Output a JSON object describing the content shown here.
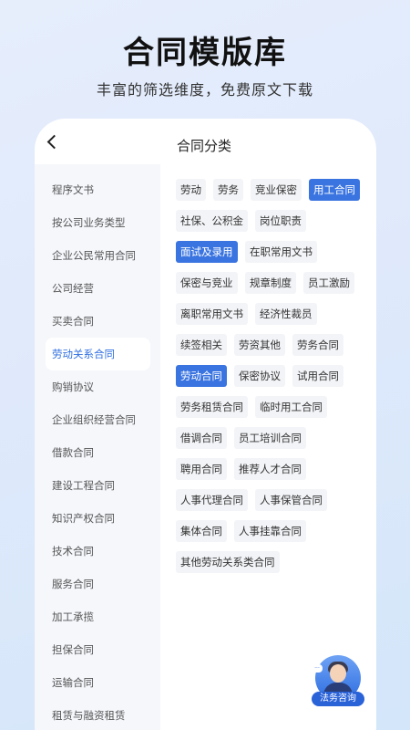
{
  "hero": {
    "title": "合同模版库",
    "subtitle": "丰富的筛选维度，免费原文下载"
  },
  "header": {
    "back_icon": "chevron-left-icon",
    "title": "合同分类"
  },
  "sidebar": {
    "items": [
      {
        "label": "程序文书",
        "active": false
      },
      {
        "label": "按公司业务类型",
        "active": false
      },
      {
        "label": "企业公民常用合同",
        "active": false
      },
      {
        "label": "公司经营",
        "active": false
      },
      {
        "label": "买卖合同",
        "active": false
      },
      {
        "label": "劳动关系合同",
        "active": true
      },
      {
        "label": "购销协议",
        "active": false
      },
      {
        "label": "企业组织经营合同",
        "active": false
      },
      {
        "label": "借款合同",
        "active": false
      },
      {
        "label": "建设工程合同",
        "active": false
      },
      {
        "label": "知识产权合同",
        "active": false
      },
      {
        "label": "技术合同",
        "active": false
      },
      {
        "label": "服务合同",
        "active": false
      },
      {
        "label": "加工承揽",
        "active": false
      },
      {
        "label": "担保合同",
        "active": false
      },
      {
        "label": "运输合同",
        "active": false
      },
      {
        "label": "租赁与融资租赁",
        "active": false
      }
    ]
  },
  "tags": {
    "rows": [
      [
        {
          "label": "劳动"
        },
        {
          "label": "劳务"
        },
        {
          "label": "竞业保密"
        },
        {
          "label": "用工合同",
          "selected": true
        }
      ],
      [
        {
          "label": "社保、公积金"
        },
        {
          "label": "岗位职责"
        }
      ],
      [
        {
          "label": "面试及录用",
          "selected": true
        },
        {
          "label": "在职常用文书"
        }
      ],
      [
        {
          "label": "保密与竞业"
        },
        {
          "label": "规章制度"
        },
        {
          "label": "员工激励"
        }
      ],
      [
        {
          "label": "离职常用文书"
        },
        {
          "label": "经济性裁员"
        }
      ],
      [
        {
          "label": "续签相关"
        },
        {
          "label": "劳资其他"
        },
        {
          "label": "劳务合同"
        }
      ],
      [
        {
          "label": "劳动合同",
          "selected": true
        },
        {
          "label": "保密协议"
        },
        {
          "label": "试用合同"
        }
      ],
      [
        {
          "label": "劳务租赁合同"
        },
        {
          "label": "临时用工合同"
        }
      ],
      [
        {
          "label": "借调合同"
        },
        {
          "label": "员工培训合同"
        }
      ],
      [
        {
          "label": "聘用合同"
        },
        {
          "label": "推荐人才合同"
        }
      ],
      [
        {
          "label": "人事代理合同"
        },
        {
          "label": "人事保管合同"
        }
      ],
      [
        {
          "label": "集体合同"
        },
        {
          "label": "人事挂靠合同"
        }
      ],
      [
        {
          "label": "其他劳动关系类合同"
        }
      ]
    ]
  },
  "consult": {
    "icon": "customer-service-avatar-icon",
    "bubble": "···",
    "label": "法务咨询"
  },
  "colors": {
    "accent": "#3a74e0",
    "active_text": "#2f6fe0",
    "sidebar_bg": "#f5f7fb",
    "tag_bg": "#f3f4f7"
  }
}
